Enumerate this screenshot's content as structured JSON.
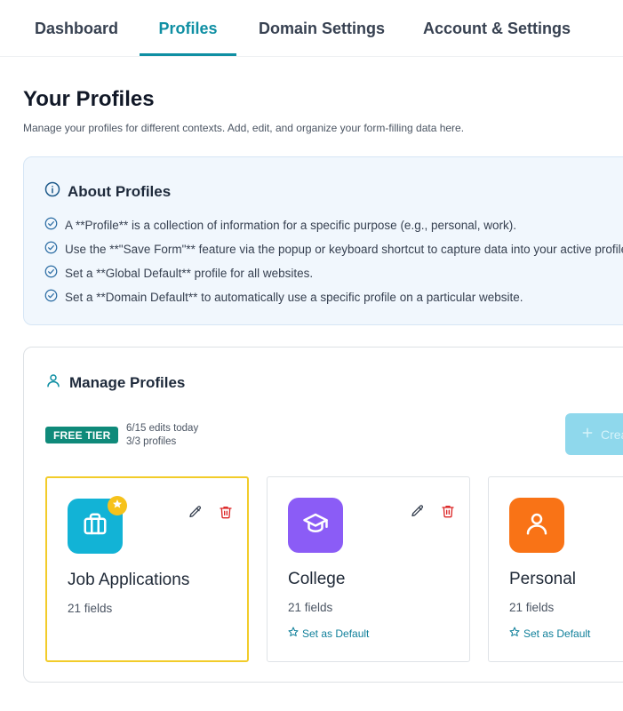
{
  "nav": {
    "tabs": [
      {
        "label": "Dashboard"
      },
      {
        "label": "Profiles"
      },
      {
        "label": "Domain Settings"
      },
      {
        "label": "Account & Settings"
      }
    ],
    "active_tab": "Profiles"
  },
  "header": {
    "title": "Your Profiles",
    "subtitle": "Manage your profiles for different contexts. Add, edit, and organize your form-filling data here."
  },
  "about": {
    "title": "About Profiles",
    "items": [
      "A **Profile** is a collection of information for a specific purpose (e.g., personal, work).",
      "Use the **\"Save Form\"** feature via the popup or keyboard shortcut to capture data into your active profile.",
      "Set a **Global Default** profile for all websites.",
      "Set a **Domain Default** to automatically use a specific profile on a particular website."
    ]
  },
  "manage": {
    "title": "Manage Profiles",
    "tier_badge": "FREE TIER",
    "edits_usage": "6/15 edits today",
    "profiles_usage": "3/3 profiles",
    "create_button": "Create"
  },
  "profiles": [
    {
      "name": "Job Applications",
      "fields": "21 fields",
      "icon": "briefcase-icon",
      "color": "#12b3d6",
      "is_default": true,
      "set_default_label": ""
    },
    {
      "name": "College",
      "fields": "21 fields",
      "icon": "graduation-cap-icon",
      "color": "#8b5cf6",
      "is_default": false,
      "set_default_label": "Set as Default"
    },
    {
      "name": "Personal",
      "fields": "21 fields",
      "icon": "user-icon",
      "color": "#f97316",
      "is_default": false,
      "set_default_label": "Set as Default"
    }
  ],
  "colors": {
    "accent": "#0f8fa3",
    "default_border": "#f2cc2a",
    "delete": "#dc2626",
    "badge": "#0f8a7a"
  }
}
